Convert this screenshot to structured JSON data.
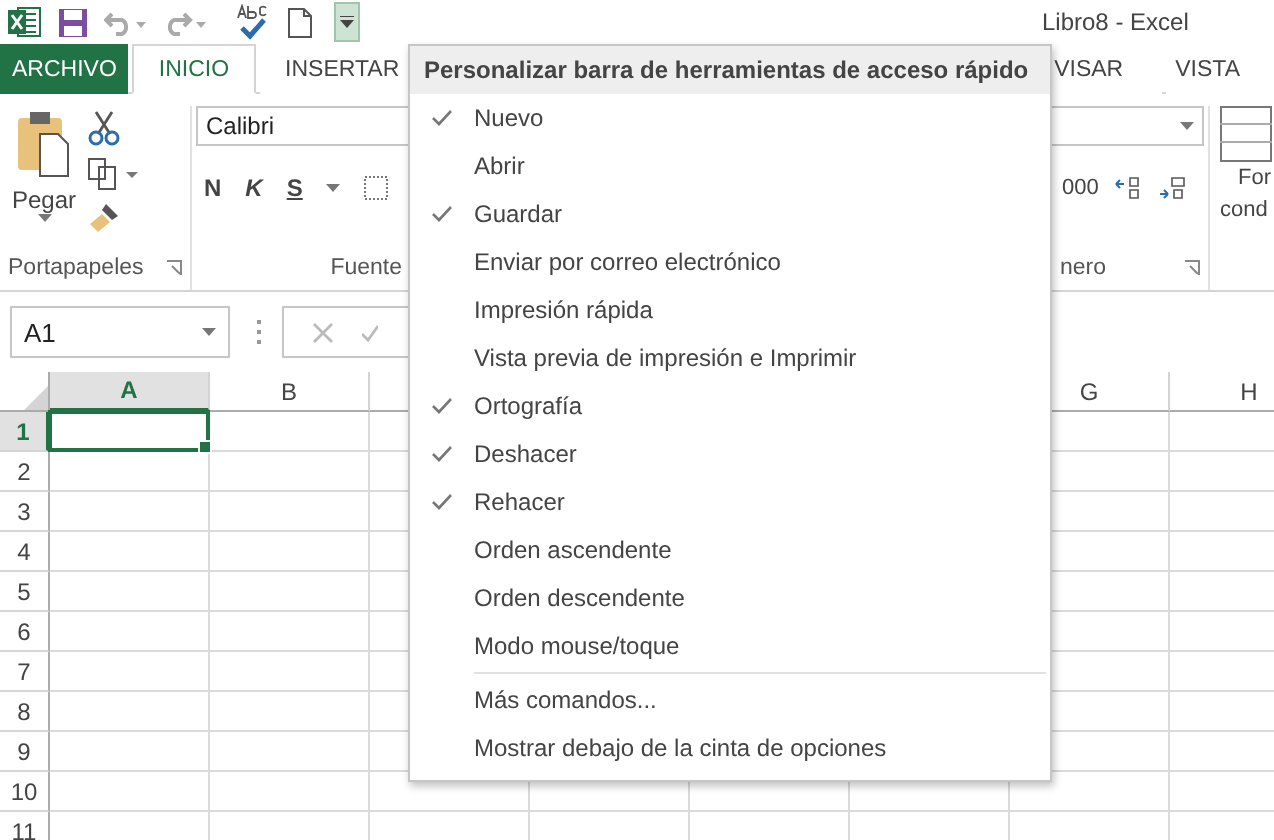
{
  "title_bar": {
    "title": "Libro8 - Excel"
  },
  "tabs": [
    {
      "label": "ARCHIVO",
      "kind": "file",
      "selected": false
    },
    {
      "label": "INICIO",
      "kind": "tab",
      "selected": true
    },
    {
      "label": "INSERTAR",
      "kind": "tab",
      "selected": false
    },
    {
      "label": "VISAR",
      "kind": "tab",
      "selected": false
    },
    {
      "label": "VISTA",
      "kind": "tab",
      "selected": false
    }
  ],
  "ribbon": {
    "clipboard": {
      "paste_label": "Pegar",
      "group_label": "Portapapeles"
    },
    "font": {
      "font_name": "Calibri",
      "bold": "N",
      "italic": "K",
      "underline": "S",
      "group_label": "Fuente"
    },
    "number": {
      "thousands": "000",
      "group_label": "nero"
    },
    "styles": {
      "button_lines": [
        "For",
        "cond"
      ]
    }
  },
  "formula_bar": {
    "name_box": "A1"
  },
  "sheet": {
    "columns": [
      {
        "label": "A",
        "selected": true
      },
      {
        "label": "B",
        "selected": false
      },
      {
        "label": "G",
        "selected": false
      },
      {
        "label": "H",
        "selected": false
      }
    ],
    "rows": [
      {
        "label": "1",
        "selected": true
      },
      {
        "label": "2",
        "selected": false
      },
      {
        "label": "3",
        "selected": false
      },
      {
        "label": "4",
        "selected": false
      },
      {
        "label": "5",
        "selected": false
      },
      {
        "label": "6",
        "selected": false
      },
      {
        "label": "7",
        "selected": false
      },
      {
        "label": "8",
        "selected": false
      },
      {
        "label": "9",
        "selected": false
      },
      {
        "label": "10",
        "selected": false
      },
      {
        "label": "11",
        "selected": false
      }
    ]
  },
  "menu": {
    "title": "Personalizar barra de herramientas de acceso rápido",
    "items": [
      {
        "label": "Nuevo",
        "kind": "toggle",
        "checked": true
      },
      {
        "label": "Abrir",
        "kind": "toggle",
        "checked": false
      },
      {
        "label": "Guardar",
        "kind": "toggle",
        "checked": true
      },
      {
        "label": "Enviar por correo electrónico",
        "kind": "toggle",
        "checked": false
      },
      {
        "label": "Impresión rápida",
        "kind": "toggle",
        "checked": false
      },
      {
        "label": "Vista previa de impresión e Imprimir",
        "kind": "toggle",
        "checked": false
      },
      {
        "label": "Ortografía",
        "kind": "toggle",
        "checked": true
      },
      {
        "label": "Deshacer",
        "kind": "toggle",
        "checked": true
      },
      {
        "label": "Rehacer",
        "kind": "toggle",
        "checked": true
      },
      {
        "label": "Orden ascendente",
        "kind": "toggle",
        "checked": false
      },
      {
        "label": "Orden descendente",
        "kind": "toggle",
        "checked": false
      },
      {
        "label": "Modo mouse/toque",
        "kind": "toggle",
        "checked": false
      },
      {
        "label": "Más comandos...",
        "kind": "command"
      },
      {
        "label": "Mostrar debajo de la cinta de opciones",
        "kind": "command"
      }
    ]
  }
}
